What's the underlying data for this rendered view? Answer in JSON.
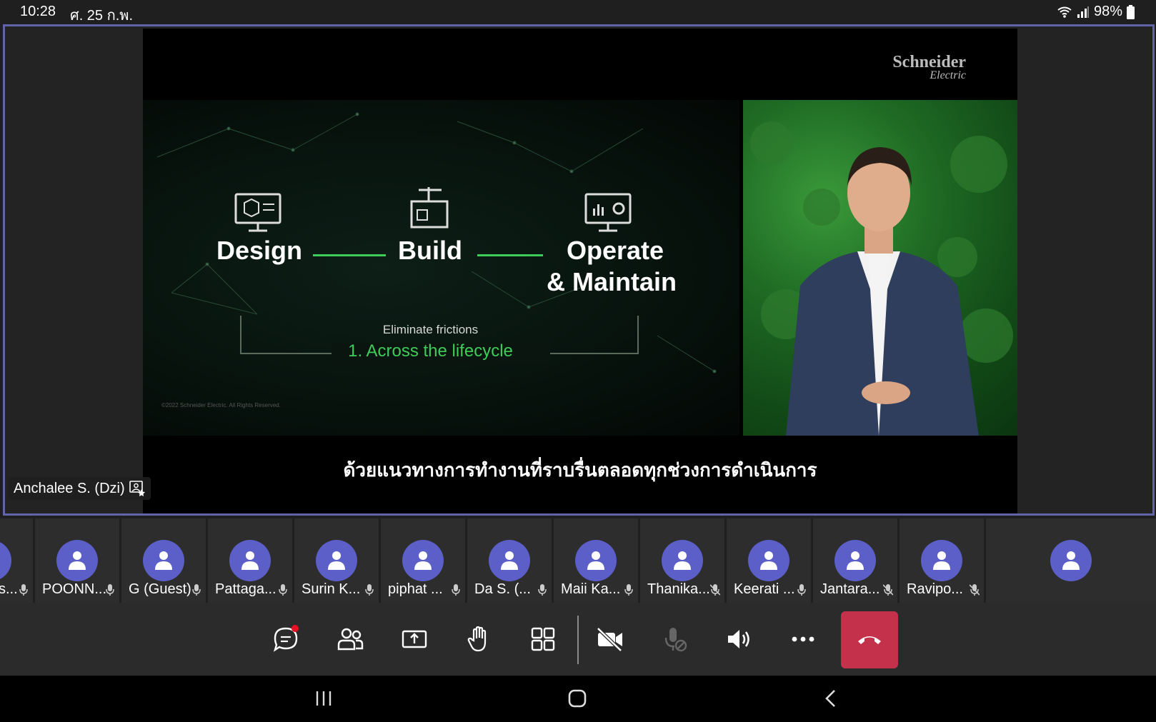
{
  "status_bar": {
    "time": "10:28",
    "date": "ศ. 25 ก.พ.",
    "battery": "98%"
  },
  "stage": {
    "participant_name": "Anchalee S. (Dzi)",
    "slide": {
      "logo_main": "Schneider",
      "logo_sub": "Electric",
      "steps": [
        "Design",
        "Build",
        "Operate",
        "& Maintain"
      ],
      "subtitle": "Eliminate frictions",
      "highlight": "1. Across the lifecycle",
      "copyright": "©2022 Schneider Electric. All Rights Reserved."
    },
    "caption": "ด้วยแนวทางการทำงานที่ราบรื่นตลอดทุกช่วงการดำเนินการ"
  },
  "participants": [
    {
      "name": "s...",
      "muted": false
    },
    {
      "name": "POONN...",
      "muted": false
    },
    {
      "name": "G (Guest)",
      "muted": false
    },
    {
      "name": "Pattaga...",
      "muted": false
    },
    {
      "name": "Surin K...",
      "muted": false
    },
    {
      "name": "piphat ...",
      "muted": false
    },
    {
      "name": "Da S. (...",
      "muted": false
    },
    {
      "name": "Maii Ka...",
      "muted": false
    },
    {
      "name": "Thanika...",
      "muted": true
    },
    {
      "name": "Keerati ...",
      "muted": false
    },
    {
      "name": "Jantara...",
      "muted": true
    },
    {
      "name": "Ravipo...",
      "muted": true
    }
  ],
  "colors": {
    "accent": "#6264a7",
    "avatar": "#5b5fc7",
    "hangup": "#c4314b",
    "slide_green": "#3dcd58",
    "notification": "#e81123"
  },
  "controls": [
    "chat-icon",
    "people-icon",
    "share-icon",
    "raise-hand-icon",
    "view-icon",
    "camera-off-icon",
    "mic-disabled-icon",
    "speaker-icon",
    "more-icon",
    "hangup-icon"
  ]
}
